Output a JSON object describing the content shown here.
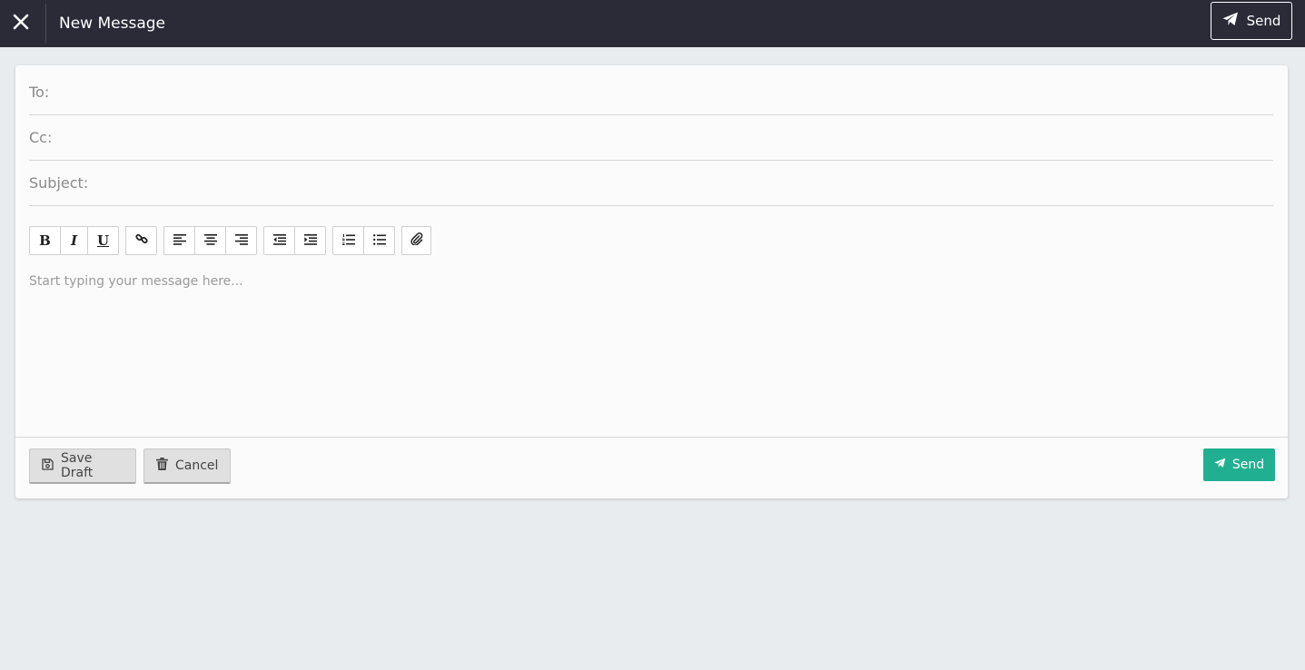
{
  "header": {
    "title": "New Message",
    "send_label": "Send",
    "background": "#2a2b37"
  },
  "form": {
    "to_label": "To:",
    "cc_label": "Cc:",
    "subject_label": "Subject:",
    "to_value": "",
    "cc_value": "",
    "subject_value": ""
  },
  "toolbar": {
    "bold": "B",
    "italic": "I",
    "underline": "U",
    "icons": [
      "link-icon",
      "align-left-icon",
      "align-center-icon",
      "align-right-icon",
      "outdent-icon",
      "indent-icon",
      "ordered-list-icon",
      "unordered-list-icon",
      "attachment-icon"
    ]
  },
  "editor": {
    "placeholder": "Start typing your message here..."
  },
  "footer": {
    "save_draft_label": "Save Draft",
    "cancel_label": "Cancel",
    "send_label": "Send",
    "send_color": "#20b091"
  }
}
